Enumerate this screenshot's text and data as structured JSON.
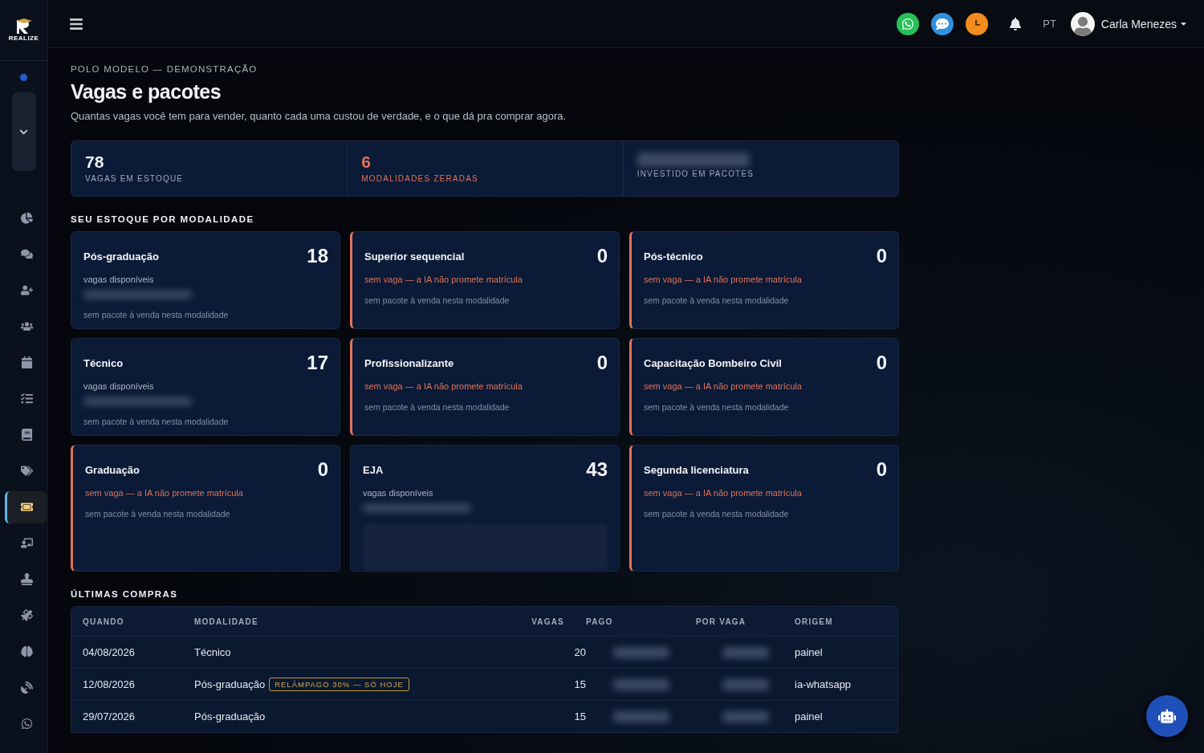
{
  "logo": {
    "text": "REALIZE"
  },
  "sidebar": {
    "items": [
      {
        "kind": "chart",
        "selected": false
      },
      {
        "kind": "chat",
        "selected": false
      },
      {
        "kind": "user-plus",
        "selected": false
      },
      {
        "kind": "users",
        "selected": false
      },
      {
        "kind": "calendar",
        "selected": false
      },
      {
        "kind": "checklist",
        "selected": false
      },
      {
        "kind": "book",
        "selected": false
      },
      {
        "kind": "tags",
        "selected": false
      },
      {
        "kind": "ticket",
        "selected": true
      },
      {
        "kind": "teacher",
        "selected": false
      },
      {
        "kind": "stamp",
        "selected": false
      },
      {
        "kind": "satellite",
        "selected": false
      },
      {
        "kind": "brain",
        "selected": false
      },
      {
        "kind": "dish",
        "selected": false
      },
      {
        "kind": "whatsapp",
        "selected": false
      }
    ]
  },
  "header": {
    "language": "PT",
    "user": "Carla Menezes"
  },
  "page": {
    "eyebrow": "POLO MODELO — DEMONSTRAÇÃO",
    "title": "Vagas e pacotes",
    "subtitle": "Quantas vagas você tem para vender, quanto cada uma custou de verdade, e o que dá pra comprar agora."
  },
  "stats": [
    {
      "value": "78",
      "label": "VAGAS EM ESTOQUE",
      "kind": "normal"
    },
    {
      "value": "6",
      "label": "MODALIDADES ZERADAS",
      "kind": "alert"
    },
    {
      "label": "INVESTIDO EM PACOTES",
      "kind": "hidden"
    }
  ],
  "stock_section": {
    "title": "SEU ESTOQUE POR MODALIDADE"
  },
  "modalities": [
    {
      "name": "Pós-graduação",
      "count": "18",
      "kind": "stocked",
      "status": "vagas disponíveis",
      "note": "sem pacote à venda nesta modalidade"
    },
    {
      "name": "Superior sequencial",
      "count": "0",
      "kind": "empty",
      "status": "sem vaga — a IA não promete matrícula",
      "note": "sem pacote à venda nesta modalidade"
    },
    {
      "name": "Pós-técnico",
      "count": "0",
      "kind": "empty",
      "status": "sem vaga — a IA não promete matrícula",
      "note": "sem pacote à venda nesta modalidade"
    },
    {
      "name": "Técnico",
      "count": "17",
      "kind": "stocked",
      "status": "vagas disponíveis",
      "note": "sem pacote à venda nesta modalidade"
    },
    {
      "name": "Profissionalizante",
      "count": "0",
      "kind": "empty",
      "status": "sem vaga — a IA não promete matrícula",
      "note": "sem pacote à venda nesta modalidade"
    },
    {
      "name": "Capacitação Bombeiro Civil",
      "count": "0",
      "kind": "empty",
      "status": "sem vaga — a IA não promete matrícula",
      "note": "sem pacote à venda nesta modalidade"
    },
    {
      "name": "Graduação",
      "count": "0",
      "kind": "empty",
      "status": "sem vaga — a IA não promete matrícula",
      "note": "sem pacote à venda nesta modalidade"
    },
    {
      "name": "EJA",
      "count": "43",
      "kind": "offer",
      "status": "vagas disponíveis"
    },
    {
      "name": "Segunda licenciatura",
      "count": "0",
      "kind": "empty",
      "status": "sem vaga — a IA não promete matrícula",
      "note": "sem pacote à venda nesta modalidade"
    }
  ],
  "purchases": {
    "title": "ÚLTIMAS COMPRAS",
    "columns": [
      "QUANDO",
      "MODALIDADE",
      "VAGAS",
      "PAGO",
      "POR VAGA",
      "ORIGEM"
    ],
    "rows": [
      {
        "date": "04/08/2026",
        "modality": "Técnico",
        "seats": "20",
        "origin": "painel"
      },
      {
        "date": "12/08/2026",
        "modality": "Pós-graduação",
        "badge": "RELÂMPAGO 30% — SÓ HOJE",
        "seats": "15",
        "origin": "ia-whatsapp"
      },
      {
        "date": "29/07/2026",
        "modality": "Pós-graduação",
        "seats": "15",
        "origin": "painel"
      }
    ]
  }
}
